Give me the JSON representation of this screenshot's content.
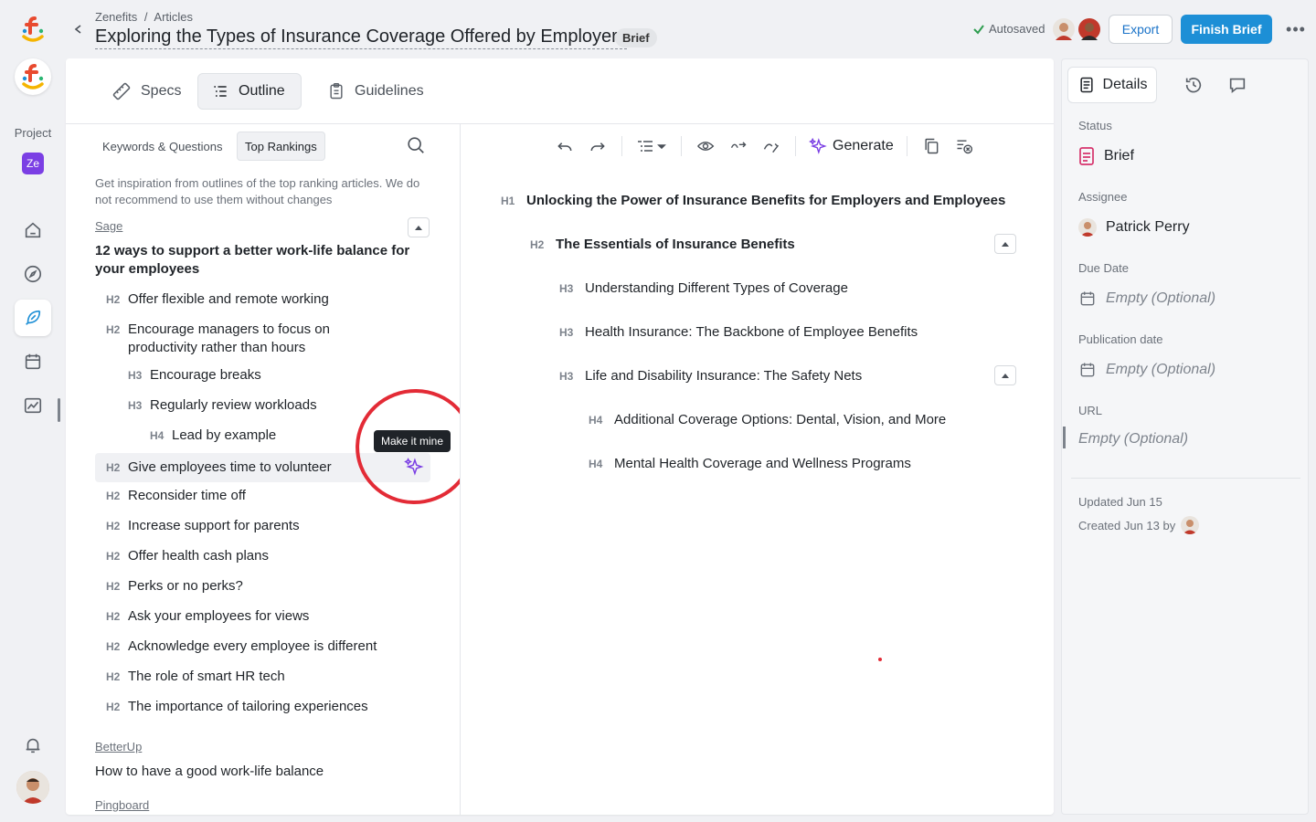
{
  "header": {
    "breadcrumb": [
      "Zenefits",
      "/",
      "Articles"
    ],
    "title": "Exploring the Types of Insurance Coverage Offered by Employers",
    "badge": "Brief",
    "autosaved": "Autosaved",
    "export_label": "Export",
    "finish_label": "Finish Brief"
  },
  "rail": {
    "project_label": "Project",
    "project_badge": "Ze"
  },
  "tabs": {
    "specs": "Specs",
    "outline": "Outline",
    "guidelines": "Guidelines"
  },
  "left": {
    "subtabs": [
      "Keywords & Questions",
      "Top Rankings"
    ],
    "hint": "Get inspiration from outlines of the top ranking articles.  We do not recommend to use them without changes",
    "source1": "Sage",
    "article1_title": "12 ways to support a better work-life balance for your employees",
    "rows": [
      {
        "lvl": "H2",
        "text": "Offer flexible and remote working"
      },
      {
        "lvl": "H2",
        "text": "Encourage managers to focus on productivity rather than hours"
      },
      {
        "lvl": "H3",
        "text": "Encourage breaks"
      },
      {
        "lvl": "H3",
        "text": "Regularly review workloads"
      },
      {
        "lvl": "H4",
        "text": "Lead by example"
      },
      {
        "lvl": "H2",
        "text": "Give employees time to volunteer"
      },
      {
        "lvl": "H2",
        "text": "Reconsider time off"
      },
      {
        "lvl": "H2",
        "text": "Increase support for parents"
      },
      {
        "lvl": "H2",
        "text": "Offer health cash plans"
      },
      {
        "lvl": "H2",
        "text": "Perks or no perks?"
      },
      {
        "lvl": "H2",
        "text": "Ask your employees for views"
      },
      {
        "lvl": "H2",
        "text": "Acknowledge every employee is different"
      },
      {
        "lvl": "H2",
        "text": "The role of smart HR tech"
      },
      {
        "lvl": "H2",
        "text": "The importance of tailoring experiences"
      }
    ],
    "tooltip": "Make it mine",
    "source2": "BetterUp",
    "article2_title": "How to have a good work-life balance",
    "source3": "Pingboard"
  },
  "toolbar": {
    "generate_label": "Generate"
  },
  "outline": [
    {
      "lvl": "H1",
      "text": "Unlocking the Power of Insurance Benefits for Employers and Employees"
    },
    {
      "lvl": "H2",
      "text": "The Essentials of Insurance Benefits"
    },
    {
      "lvl": "H3",
      "text": "Understanding Different Types of Coverage"
    },
    {
      "lvl": "H3",
      "text": "Health Insurance: The Backbone of Employee Benefits"
    },
    {
      "lvl": "H3",
      "text": "Life and Disability Insurance: The Safety Nets"
    },
    {
      "lvl": "H4",
      "text": "Additional Coverage Options: Dental, Vision, and More"
    },
    {
      "lvl": "H4",
      "text": "Mental Health Coverage and Wellness Programs"
    }
  ],
  "sidebar": {
    "details_tab": "Details",
    "status_label": "Status",
    "status_value": "Brief",
    "assignee_label": "Assignee",
    "assignee_value": "Patrick Perry",
    "due_label": "Due Date",
    "due_value": "Empty (Optional)",
    "pub_label": "Publication date",
    "pub_value": "Empty (Optional)",
    "url_label": "URL",
    "url_value": "Empty (Optional)",
    "updated": "Updated Jun 15",
    "created": "Created Jun 13 by"
  },
  "colors": {
    "accent": "#1d8fd6",
    "project": "#7b3fe4",
    "annotation": "#e32b36",
    "status_icon": "#d6336c"
  }
}
